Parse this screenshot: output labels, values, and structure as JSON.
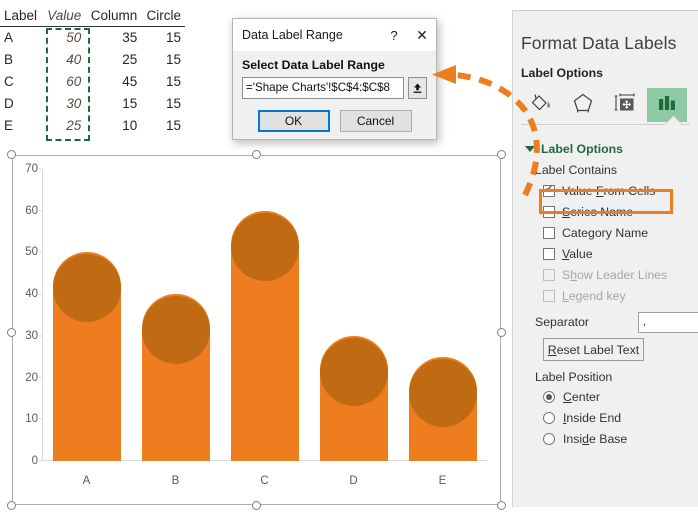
{
  "sheet": {
    "headers": [
      "Label",
      "Value",
      "Column",
      "Circle"
    ],
    "rows": [
      {
        "label": "A",
        "value": "50",
        "column": "35",
        "circle": "15"
      },
      {
        "label": "B",
        "value": "40",
        "column": "25",
        "circle": "15"
      },
      {
        "label": "C",
        "value": "60",
        "column": "45",
        "circle": "15"
      },
      {
        "label": "D",
        "value": "30",
        "column": "15",
        "circle": "15"
      },
      {
        "label": "E",
        "value": "25",
        "column": "10",
        "circle": "15"
      }
    ]
  },
  "dialog": {
    "title": "Data Label Range",
    "help_icon": "?",
    "close_icon": "✕",
    "field_label": "Select Data Label Range",
    "range_value": "='Shape Charts'!$C$4:$C$8",
    "picker_icon": "range-picker-icon",
    "ok_label": "OK",
    "cancel_label": "Cancel"
  },
  "panel": {
    "title": "Format Data Labels",
    "subtitle": "Label Options",
    "tabs": [
      {
        "name": "fill-and-line-tab",
        "icon": "paint-bucket-icon",
        "selected": false
      },
      {
        "name": "effects-tab",
        "icon": "pentagon-icon",
        "selected": false
      },
      {
        "name": "size-and-properties-tab",
        "icon": "size-properties-icon",
        "selected": false
      },
      {
        "name": "label-options-tab",
        "icon": "bar-chart-icon",
        "selected": true
      }
    ],
    "section_title": "Label Options",
    "label_contains": "Label Contains",
    "checkboxes": [
      {
        "label": "Value From Cells",
        "accel": "F",
        "checked": true,
        "disabled": false,
        "highlighted": true
      },
      {
        "label": "Series Name",
        "accel": "S",
        "checked": false,
        "disabled": false,
        "highlighted": false
      },
      {
        "label": "Category Name",
        "accel": "g",
        "checked": false,
        "disabled": false,
        "highlighted": false
      },
      {
        "label": "Value",
        "accel": "V",
        "checked": false,
        "disabled": false,
        "highlighted": false
      },
      {
        "label": "Show Leader Lines",
        "accel": "h",
        "checked": false,
        "disabled": true,
        "highlighted": false
      },
      {
        "label": "Legend key",
        "accel": "L",
        "checked": false,
        "disabled": true,
        "highlighted": false
      }
    ],
    "separator_label": "Separator",
    "separator_value": ",",
    "reset_label": "Reset Label Text",
    "label_position_label": "Label Position",
    "radios": [
      {
        "label": "Center",
        "accel": "C",
        "selected": true
      },
      {
        "label": "Inside End",
        "accel": "I",
        "selected": false
      },
      {
        "label": "Inside Base",
        "accel": "d",
        "selected": false
      }
    ],
    "accent_green": "#1e6b3c",
    "highlight_orange": "#ED7D1F"
  },
  "chart_data": {
    "type": "bar",
    "title": "",
    "xlabel": "",
    "ylabel": "",
    "categories": [
      "A",
      "B",
      "C",
      "D",
      "E"
    ],
    "series": [
      {
        "name": "Column",
        "values": [
          35,
          25,
          45,
          15,
          10
        ]
      },
      {
        "name": "Circle",
        "values": [
          15,
          15,
          15,
          15,
          15
        ]
      }
    ],
    "values": [
      50,
      40,
      60,
      30,
      25
    ],
    "yticks": [
      0,
      10,
      20,
      30,
      40,
      50,
      60,
      70
    ],
    "ylim": [
      0,
      70
    ],
    "grid": false,
    "legend": "none",
    "bar_color": "#ED7D1F",
    "circle_color": "#C06A14"
  }
}
